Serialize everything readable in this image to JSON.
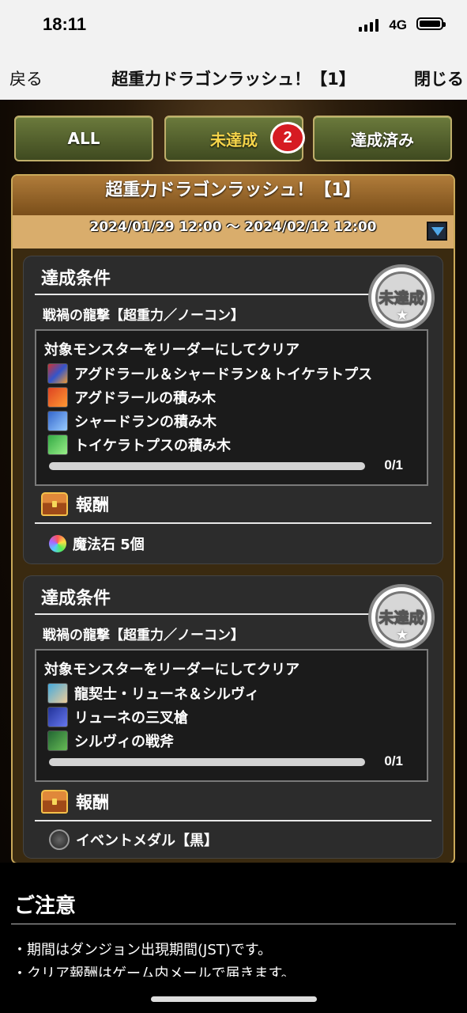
{
  "status_bar": {
    "time": "18:11",
    "network": "4G"
  },
  "nav": {
    "back": "戻る",
    "title": "超重力ドラゴンラッシュ！【1】",
    "close": "閉じる"
  },
  "tabs": [
    {
      "label": "ALL",
      "active": false
    },
    {
      "label": "未達成",
      "active": true,
      "badge": "2"
    },
    {
      "label": "達成済み",
      "active": false
    }
  ],
  "panel": {
    "title": "超重力ドラゴンラッシュ！【1】",
    "period": "2024/01/29 12:00 〜 2024/02/12 12:00"
  },
  "missions": [
    {
      "title": "達成条件",
      "status": "未達成",
      "dungeon": "戦禍の龍撃【超重力／ノーコン】",
      "condition": "対象モンスターをリーダーにしてクリア",
      "monsters": [
        "アグドラール＆シャードラン＆トイケラトプス",
        "アグドラールの積み木",
        "シャードランの積み木",
        "トイケラトプスの積み木"
      ],
      "progress": "0/1",
      "reward_label": "報酬",
      "reward": "魔法石 5個"
    },
    {
      "title": "達成条件",
      "status": "未達成",
      "dungeon": "戦禍の龍撃【超重力／ノーコン】",
      "condition": "対象モンスターをリーダーにしてクリア",
      "monsters": [
        "龍契士・リューネ＆シルヴィ",
        "リューネの三叉槍",
        "シルヴィの戦斧"
      ],
      "progress": "0/1",
      "reward_label": "報酬",
      "reward": "イベントメダル【黒】"
    }
  ],
  "notes": {
    "title": "ご注意",
    "items": [
      "・期間はダンジョン出現期間(JST)です。",
      "・クリア報酬はゲーム内メールで届きます。"
    ]
  }
}
